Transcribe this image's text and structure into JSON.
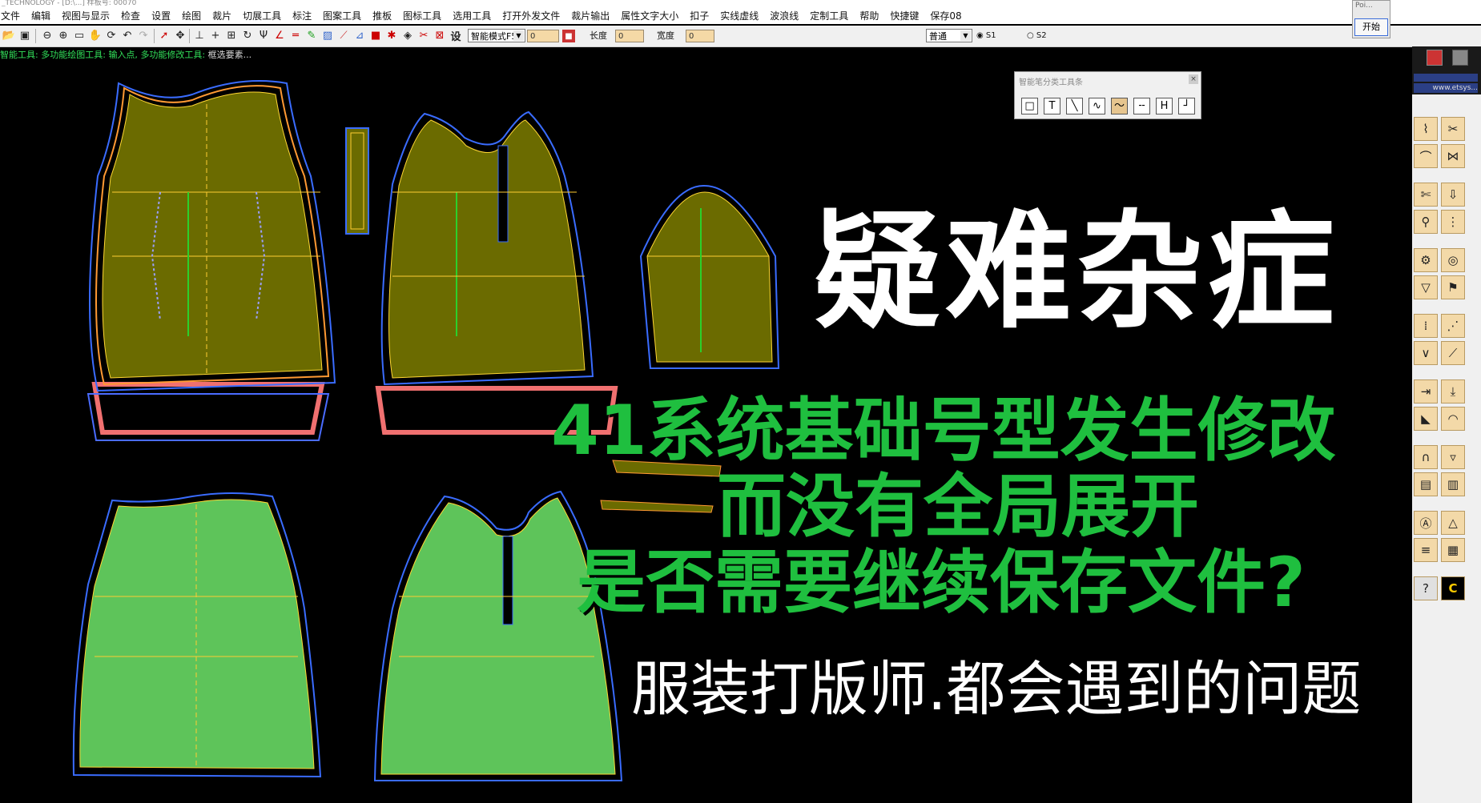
{
  "window": {
    "title": "_TECHNOLOGY - [D:\\...] 样板号: 00070"
  },
  "menu": [
    "文件",
    "编辑",
    "视图与显示",
    "检查",
    "设置",
    "绘图",
    "裁片",
    "切展工具",
    "标注",
    "图案工具",
    "推板",
    "图标工具",
    "选用工具",
    "打开外发文件",
    "裁片输出",
    "属性文字大小",
    "扣子",
    "实线虚线",
    "波浪线",
    "定制工具",
    "帮助",
    "快捷键",
    "保存08"
  ],
  "toolbar": {
    "mode_combo": "智能模式F5",
    "length_label": "长度",
    "width_label": "宽度",
    "field_1": "0",
    "field_2": "0",
    "field_3": "0",
    "preset_combo": "普通",
    "radio_s1": "S1",
    "radio_s2": "S2"
  },
  "statusbar": {
    "tool": "智能工具:",
    "draw_tool": "多功能绘图工具:",
    "input_point": "输入点,",
    "modify_tool": "多功能修改工具:",
    "select": "框选要素..."
  },
  "start_window": {
    "title": "Poi...",
    "button": "开始"
  },
  "smart_panel": {
    "title": "智能笔分类工具条",
    "icons": [
      "rectangle-tool-icon",
      "text-tool-icon",
      "line-tool-icon",
      "wave-tool-icon",
      "curve-tool-icon",
      "dash-line-icon",
      "h-tool-icon",
      "corner-tool-icon"
    ]
  },
  "right_panel": {
    "brand": "www.etsys..."
  },
  "overlay": {
    "headline": "疑难杂症",
    "line1": "41系统基础号型发生修改",
    "line2": "而没有全局展开",
    "line3": "是否需要继续保存文件?",
    "line4": "服装打版师.都会遇到的问题"
  },
  "colors": {
    "olive_piece": "#6b6b00",
    "green_piece": "#5ec45a",
    "accent_green": "#1fbf3f",
    "toolbar_bg": "#f0f0f0"
  }
}
